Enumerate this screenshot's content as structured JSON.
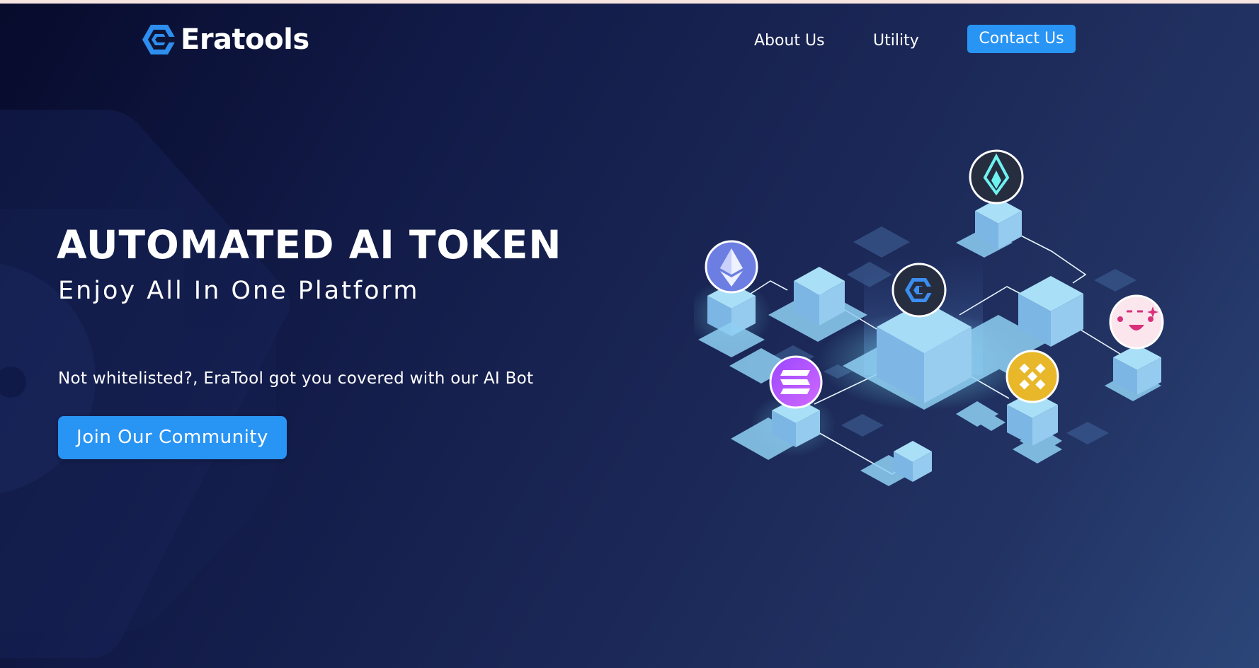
{
  "brand": {
    "name": "Eratools",
    "accent": "#2894f4"
  },
  "nav": {
    "items": [
      {
        "label": "About Us"
      },
      {
        "label": "Utility"
      }
    ],
    "contact_label": "Contact Us"
  },
  "hero": {
    "title": "AUTOMATED AI TOKEN",
    "subtitle": "Enjoy All In One Platform",
    "description": "Not whitelisted?, EraTool got you covered with our AI Bot",
    "cta_label": "Join Our Community"
  },
  "illustration": {
    "tokens": [
      "ethereum-icon",
      "eratools-icon",
      "arweave-icon",
      "solana-icon",
      "binance-icon",
      "meme-face-icon"
    ]
  }
}
